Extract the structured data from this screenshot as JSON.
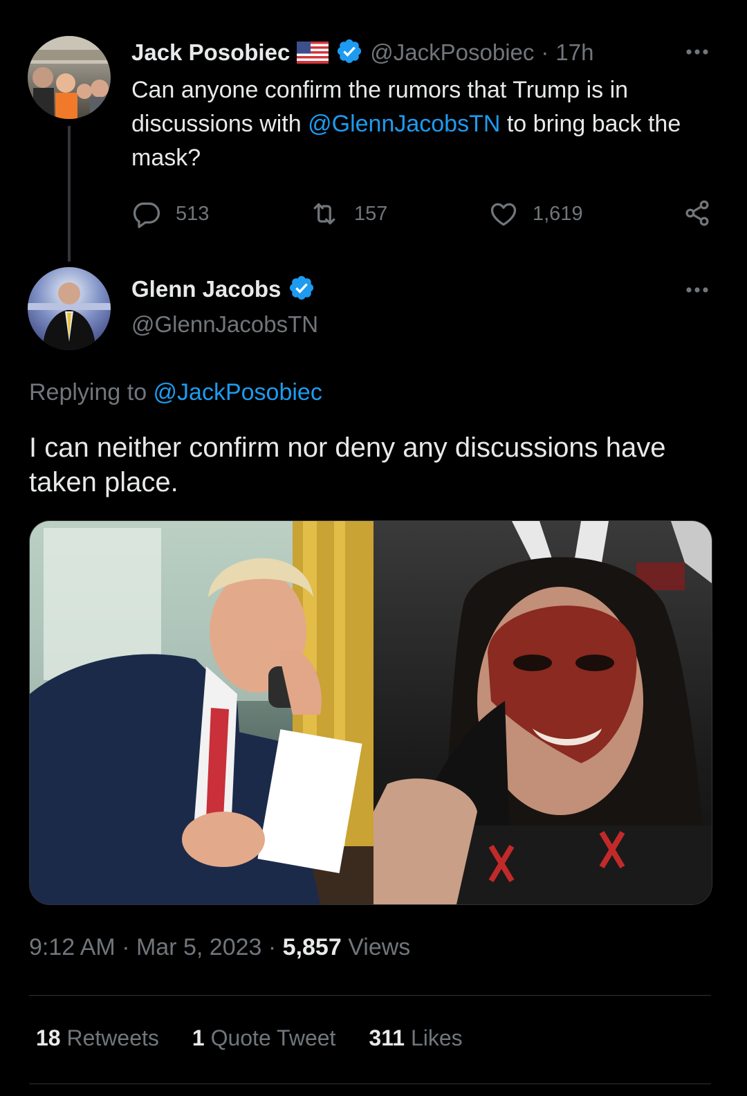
{
  "tweet1": {
    "display_name": "Jack Posobiec",
    "flag_icon": "us-flag-icon",
    "handle": "@JackPosobiec",
    "time_sep": "·",
    "time": "17h",
    "text_before": "Can anyone confirm the rumors that Trump is in discussions with ",
    "mention": "@GlennJacobsTN",
    "text_after": " to bring back the mask?",
    "replies": "513",
    "retweets": "157",
    "likes": "1,619"
  },
  "tweet2": {
    "display_name": "Glenn Jacobs",
    "handle": "@GlennJacobsTN",
    "replying_label": "Replying to ",
    "replying_to": "@JackPosobiec",
    "text": "I can neither confirm nor deny any discussions have taken place.",
    "time": "9:12 AM",
    "date_sep": "·",
    "date": "Mar 5, 2023",
    "views_sep": "·",
    "views_count": "5,857",
    "views_label": "Views",
    "retweets_count": "18",
    "retweets_label": "Retweets",
    "quotes_count": "1",
    "quotes_label": "Quote Tweet",
    "likes_count": "311",
    "likes_label": "Likes"
  },
  "icons": {
    "more": "more-icon",
    "reply": "reply-icon",
    "retweet": "retweet-icon",
    "like": "heart-icon",
    "share": "share-icon",
    "verified": "verified-badge-icon"
  },
  "colors": {
    "background": "#000000",
    "text": "#e7e9ea",
    "muted": "#71767b",
    "link": "#1d9bf0",
    "verified": "#1d9bf0",
    "divider": "#2f3336"
  }
}
